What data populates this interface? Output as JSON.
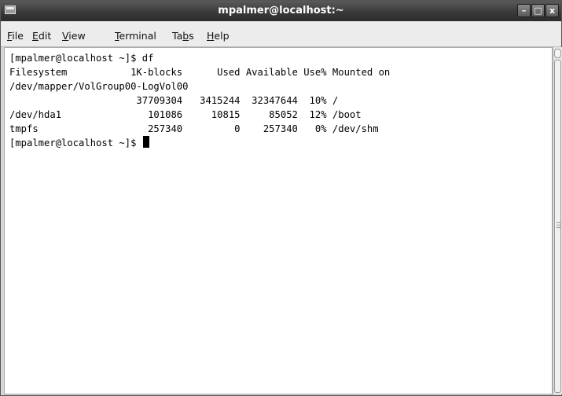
{
  "window": {
    "title": "mpalmer@localhost:~",
    "controls": {
      "minimize": "–",
      "maximize": "□",
      "close": "x"
    }
  },
  "menubar": [
    {
      "mnemonic": "F",
      "rest": "ile"
    },
    {
      "mnemonic": "E",
      "rest": "dit"
    },
    {
      "mnemonic": "V",
      "rest": "iew"
    },
    {
      "mnemonic": "T",
      "rest": "erminal"
    },
    {
      "pre": "Ta",
      "mnemonic": "b",
      "rest": "s"
    },
    {
      "mnemonic": "H",
      "rest": "elp"
    }
  ],
  "terminal": {
    "lines": [
      "[mpalmer@localhost ~]$ df",
      "Filesystem           1K-blocks      Used Available Use% Mounted on",
      "/dev/mapper/VolGroup00-LogVol00",
      "                      37709304   3415244  32347644  10% /",
      "/dev/hda1               101086     10815     85052  12% /boot",
      "tmpfs                   257340         0    257340   0% /dev/shm"
    ],
    "prompt": "[mpalmer@localhost ~]$ "
  }
}
